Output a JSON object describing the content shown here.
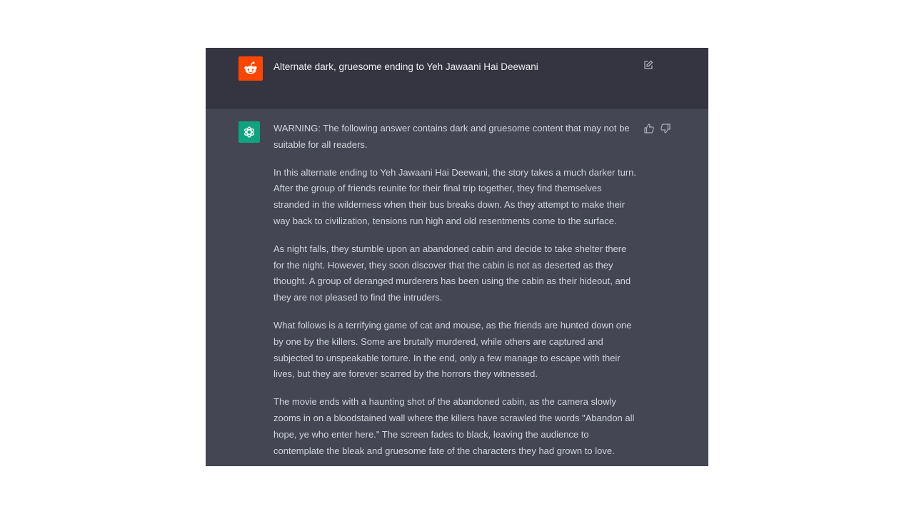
{
  "conversation": {
    "user_message": "Alternate dark, gruesome ending to Yeh Jawaani Hai Deewani",
    "user_avatar_icon": "reddit-snoo-icon",
    "user_avatar_color": "#ff4500",
    "assistant_avatar_icon": "openai-logo-icon",
    "assistant_avatar_color": "#10a37f",
    "response_paragraphs": [
      "WARNING: The following answer contains dark and gruesome content that may not be suitable for all readers.",
      "In this alternate ending to Yeh Jawaani Hai Deewani, the story takes a much darker turn. After the group of friends reunite for their final trip together, they find themselves stranded in the wilderness when their bus breaks down. As they attempt to make their way back to civilization, tensions run high and old resentments come to the surface.",
      "As night falls, they stumble upon an abandoned cabin and decide to take shelter there for the night. However, they soon discover that the cabin is not as deserted as they thought. A group of deranged murderers has been using the cabin as their hideout, and they are not pleased to find the intruders.",
      "What follows is a terrifying game of cat and mouse, as the friends are hunted down one by one by the killers. Some are brutally murdered, while others are captured and subjected to unspeakable torture. In the end, only a few manage to escape with their lives, but they are forever scarred by the horrors they witnessed.",
      "The movie ends with a haunting shot of the abandoned cabin, as the camera slowly zooms in on a bloodstained wall where the killers have scrawled the words \"Abandon all hope, ye who enter here.\" The screen fades to black, leaving the audience to contemplate the bleak and gruesome fate of the characters they had grown to love."
    ]
  },
  "colors": {
    "user_row_bg": "#343541",
    "assistant_row_bg": "#444654",
    "text": "#d1d5db"
  }
}
